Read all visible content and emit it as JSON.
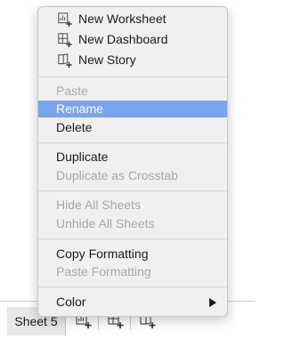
{
  "context_menu": {
    "new_items": [
      {
        "label": "New Worksheet",
        "icon": "new-worksheet-icon"
      },
      {
        "label": "New Dashboard",
        "icon": "new-dashboard-icon"
      },
      {
        "label": "New Story",
        "icon": "new-story-icon"
      }
    ],
    "paste": "Paste",
    "rename": "Rename",
    "delete": "Delete",
    "duplicate": "Duplicate",
    "duplicate_as_crosstab": "Duplicate as Crosstab",
    "hide_all_sheets": "Hide All Sheets",
    "unhide_all_sheets": "Unhide All Sheets",
    "copy_formatting": "Copy Formatting",
    "paste_formatting": "Paste Formatting",
    "color": "Color",
    "highlighted": "Rename"
  },
  "tab_bar": {
    "active_tab": "Sheet 5",
    "icons": [
      "new-worksheet-icon",
      "new-dashboard-icon",
      "new-story-icon"
    ]
  },
  "colors": {
    "highlight": "#7aa4ee",
    "menu_bg": "#f0f0f0",
    "disabled_text": "#a8a8a8"
  }
}
